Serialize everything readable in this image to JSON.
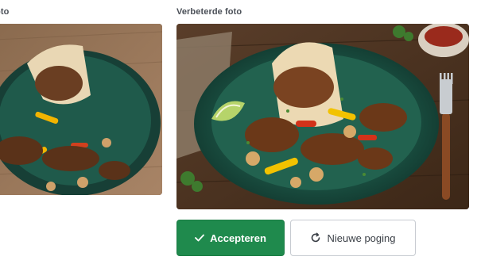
{
  "original_photo": {
    "label": "oto"
  },
  "improved_photo": {
    "label": "Verbeterde foto"
  },
  "actions": {
    "accept_label": "Accepteren",
    "retry_label": "Nieuwe poging"
  },
  "colors": {
    "accept_bg": "#1f8a4d",
    "retry_border": "#c7cbd1",
    "plate": "#1e5a4a"
  },
  "icons": {
    "accept": "checkmark-icon",
    "retry": "refresh-icon"
  }
}
